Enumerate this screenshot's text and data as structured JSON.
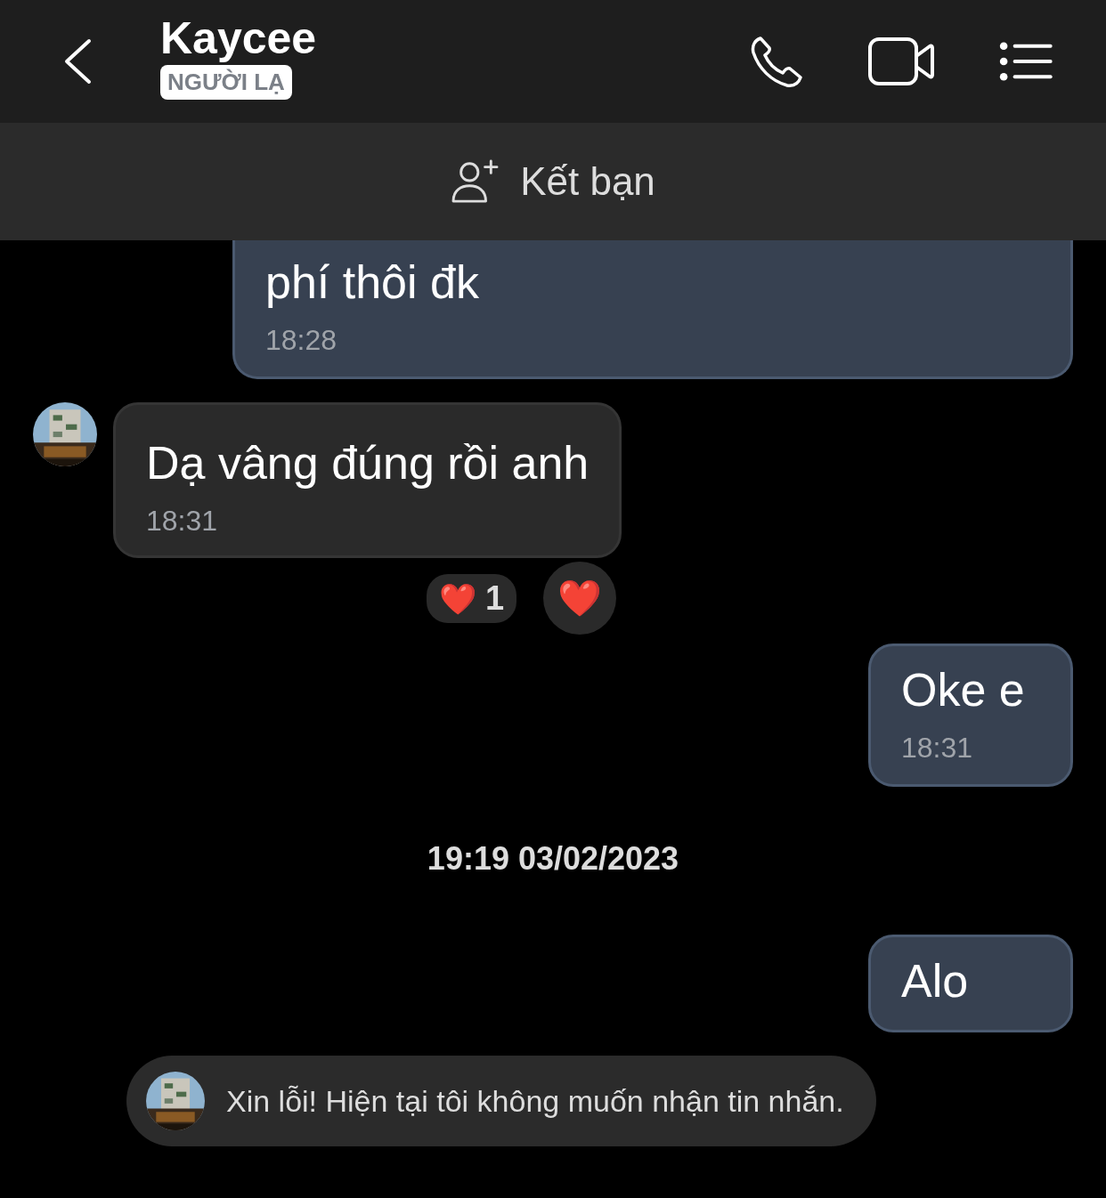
{
  "header": {
    "title": "Kaycee",
    "badge": "NGƯỜI LẠ"
  },
  "add_friend": {
    "label": "Kết bạn"
  },
  "messages": [
    {
      "kind": "out",
      "text": "phí thôi đk",
      "time": "18:28"
    },
    {
      "kind": "in",
      "text": "Dạ vâng đúng rồi anh",
      "time": "18:31",
      "reactions": [
        {
          "emoji": "❤️",
          "count": "1"
        }
      ],
      "my_reaction": "❤️"
    },
    {
      "kind": "out",
      "text": "Oke e",
      "time": "18:31"
    },
    {
      "kind": "date",
      "text": "19:19 03/02/2023"
    },
    {
      "kind": "out",
      "text": "Alo"
    }
  ],
  "notice": {
    "text": "Xin lỗi! Hiện tại tôi không muốn nhận tin nhắn."
  }
}
